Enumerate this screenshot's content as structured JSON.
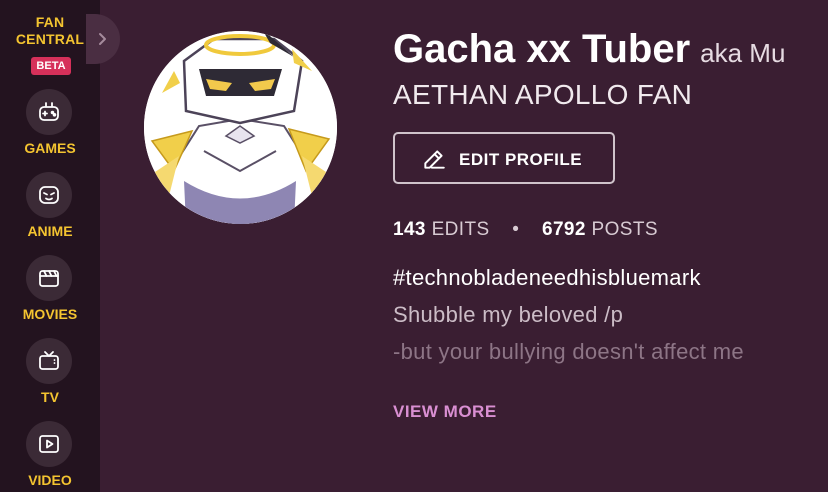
{
  "sidebar": {
    "brand_line1": "FAN",
    "brand_line2": "CENTRAL",
    "beta_badge": "BETA",
    "items": [
      {
        "label": "GAMES",
        "icon": "gamepad-icon"
      },
      {
        "label": "ANIME",
        "icon": "anime-face-icon"
      },
      {
        "label": "MOVIES",
        "icon": "clapperboard-icon"
      },
      {
        "label": "TV",
        "icon": "tv-icon"
      },
      {
        "label": "VIDEO",
        "icon": "play-icon"
      }
    ],
    "accent_color": "#f4c430",
    "beta_color": "#d6305a"
  },
  "profile": {
    "username": "Gacha xx Tuber",
    "aka": "aka Mu",
    "tagline": "AETHAN APOLLO FAN",
    "edit_label": "EDIT PROFILE",
    "edits_count": "143",
    "edits_label": "EDITS",
    "separator": "•",
    "posts_count": "6792",
    "posts_label": "POSTS",
    "bio": [
      "#technobladeneedhisbluemark",
      "Shubble my beloved /p",
      "-but your bullying doesn't affect me"
    ],
    "view_more_label": "VIEW MORE",
    "link_color": "#d98fd2",
    "background_color": "#3a1e32"
  }
}
